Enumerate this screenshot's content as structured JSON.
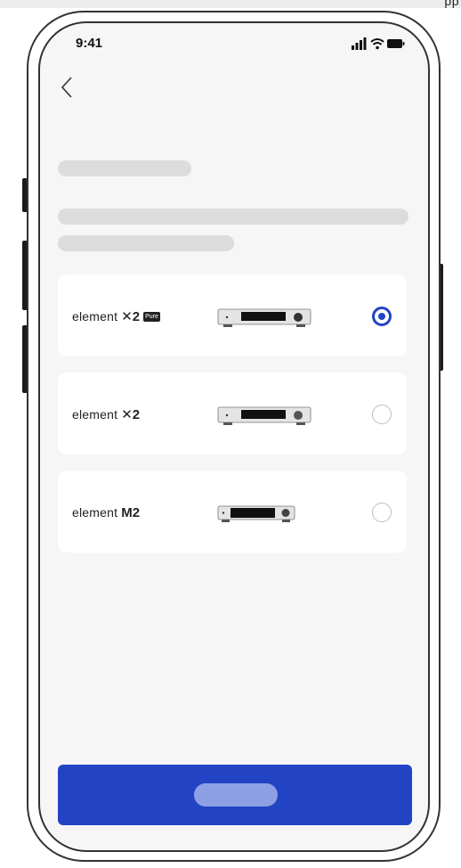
{
  "top_strip": {
    "text": "pp"
  },
  "status_bar": {
    "time": "9:41",
    "icons": [
      "signal-icon",
      "wifi-icon",
      "battery-icon"
    ]
  },
  "nav": {
    "back_icon": "chevron-left-icon"
  },
  "options": [
    {
      "brand_word": "element",
      "model_mark": "✕2",
      "badge": "Pure",
      "selected": true
    },
    {
      "brand_word": "element",
      "model_mark": "✕2",
      "badge": "",
      "selected": false
    },
    {
      "brand_word": "element",
      "model_mark": "M2",
      "badge": "",
      "selected": false
    }
  ],
  "colors": {
    "accent": "#2244c4",
    "accent_light": "#8ea0e4",
    "skeleton": "#dcdcdc",
    "screen_background": "#f6f6f6",
    "card_background": "#ffffff"
  }
}
